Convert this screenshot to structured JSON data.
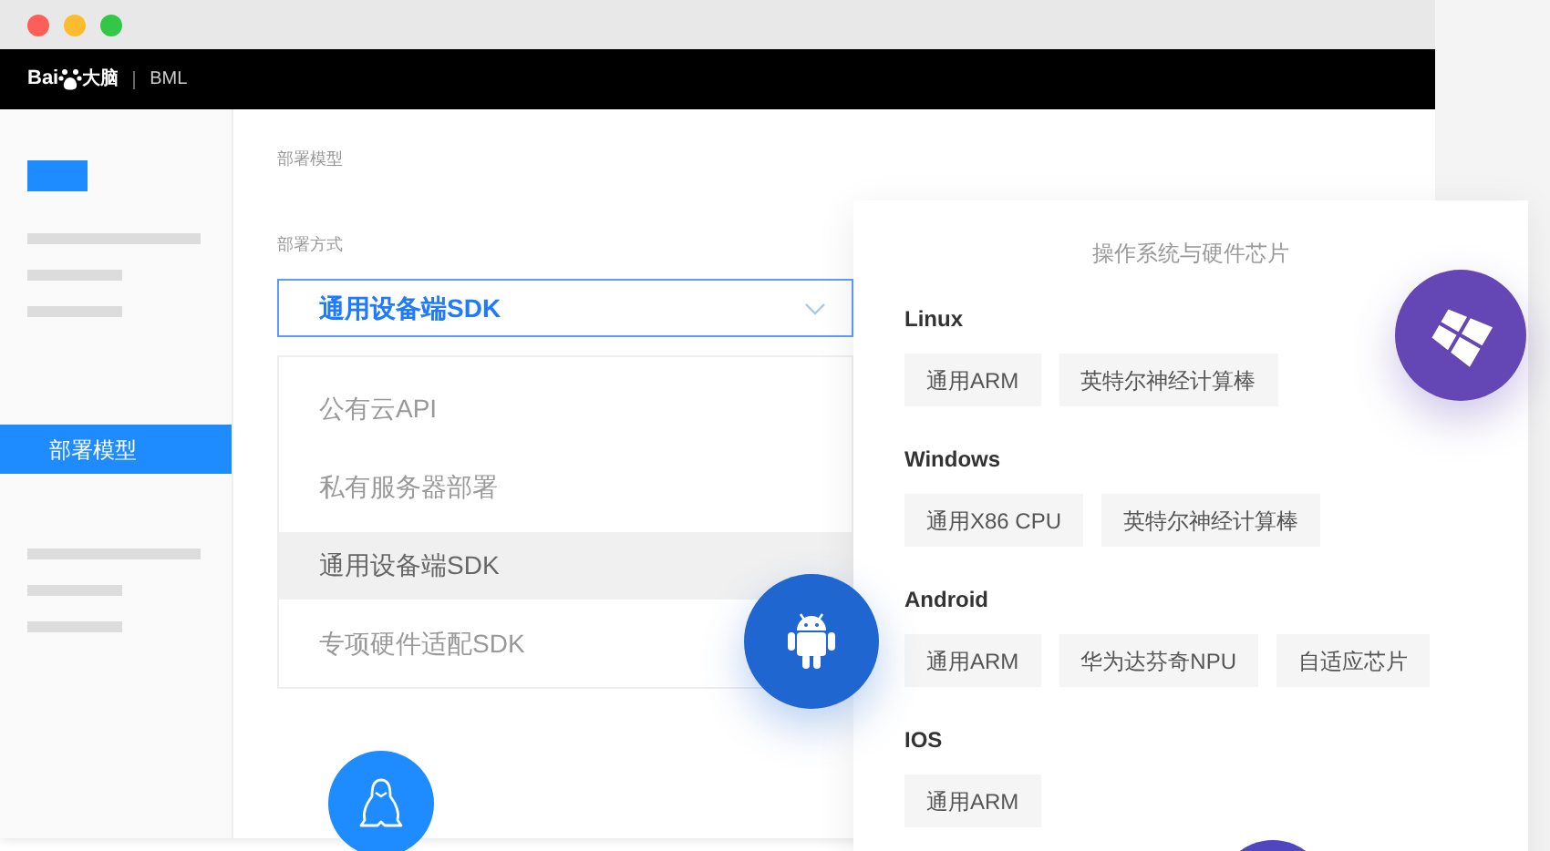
{
  "header": {
    "logo_latin": "Bai",
    "logo_cjk": "大脑",
    "product": "BML"
  },
  "sidebar": {
    "items": [
      {
        "label": "部署模型",
        "selected": true
      }
    ]
  },
  "content": {
    "breadcrumb": "部署模型",
    "field_label": "部署方式",
    "select": {
      "value": "通用设备端SDK",
      "expanded": true,
      "options": [
        {
          "label": "公有云API",
          "selected": false
        },
        {
          "label": "私有服务器部署",
          "selected": false
        },
        {
          "label": "通用设备端SDK",
          "selected": true
        },
        {
          "label": "专项硬件适配SDK",
          "selected": false
        }
      ]
    }
  },
  "panel": {
    "title": "操作系统与硬件芯片",
    "groups": [
      {
        "name": "Linux",
        "chips": [
          "通用ARM",
          "英特尔神经计算棒"
        ]
      },
      {
        "name": "Windows",
        "chips": [
          "通用X86 CPU",
          "英特尔神经计算棒"
        ]
      },
      {
        "name": "Android",
        "chips": [
          "通用ARM",
          "华为达芬奇NPU",
          "自适应芯片"
        ]
      },
      {
        "name": "IOS",
        "chips": [
          "通用ARM"
        ]
      }
    ]
  }
}
